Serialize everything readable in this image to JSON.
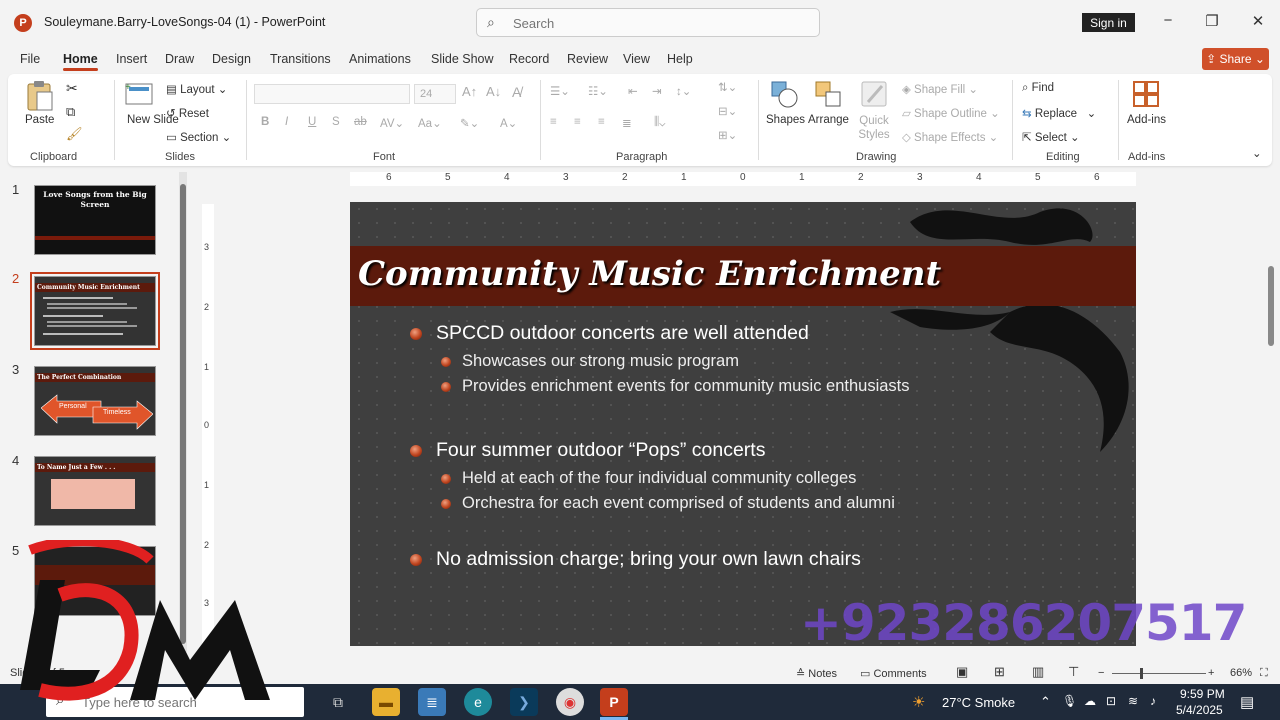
{
  "window": {
    "doc_title": "Souleymane.Barry-LoveSongs-04 (1)  -  PowerPoint",
    "search_placeholder": "Search",
    "sign_in": "Sign in",
    "minimize": "−",
    "restore": "❐",
    "close": "✕"
  },
  "menu": {
    "tabs": [
      "File",
      "Home",
      "Insert",
      "Draw",
      "Design",
      "Transitions",
      "Animations",
      "Slide Show",
      "Record",
      "Review",
      "View",
      "Help"
    ],
    "active": "Home",
    "share": "Share"
  },
  "ribbon": {
    "clipboard": {
      "label": "Clipboard",
      "paste": "Paste"
    },
    "slides": {
      "label": "Slides",
      "new_slide": "New Slide",
      "layout": "Layout",
      "reset": "Reset",
      "section": "Section"
    },
    "font": {
      "label": "Font",
      "size": "24"
    },
    "paragraph": {
      "label": "Paragraph"
    },
    "drawing": {
      "label": "Drawing",
      "shapes": "Shapes",
      "arrange": "Arrange",
      "quick_styles": "Quick Styles",
      "shape_fill": "Shape Fill",
      "shape_outline": "Shape Outline",
      "shape_effects": "Shape Effects"
    },
    "editing": {
      "label": "Editing",
      "find": "Find",
      "replace": "Replace",
      "select": "Select"
    },
    "addins": {
      "label": "Add-ins",
      "button": "Add-ins"
    }
  },
  "thumbnails": [
    {
      "num": "1",
      "title": "Love Songs from the Big Screen"
    },
    {
      "num": "2",
      "title": "Community Music Enrichment",
      "selected": true
    },
    {
      "num": "3",
      "title": "The Perfect Combination",
      "left": "Personal",
      "right": "Timeless"
    },
    {
      "num": "4",
      "title": "To Name Just a Few . . ."
    },
    {
      "num": "5",
      "title": ""
    }
  ],
  "ruler": {
    "h_ticks": [
      "6",
      "5",
      "4",
      "3",
      "2",
      "1",
      "0",
      "1",
      "2",
      "3",
      "4",
      "5",
      "6"
    ],
    "v_ticks": [
      "3",
      "2",
      "1",
      "0",
      "1",
      "2",
      "3"
    ]
  },
  "slide": {
    "title": "Community Music Enrichment",
    "bullets": [
      {
        "text": "SPCCD outdoor concerts are well attended",
        "subs": [
          "Showcases our strong music program",
          "Provides enrichment events for community music enthusiasts"
        ]
      },
      {
        "text": "Four summer outdoor “Pops” concerts",
        "subs": [
          "Held at each of the four individual community colleges",
          "Orchestra for each event comprised of students and alumni"
        ]
      },
      {
        "text": "No admission charge; bring your own lawn chairs",
        "subs": []
      }
    ]
  },
  "statusbar": {
    "slide_info": "Slide 2 of 5",
    "notes": "Notes",
    "comments": "Comments",
    "zoom": "66%"
  },
  "watermark": {
    "phone": "+923286207517"
  },
  "taskbar": {
    "search_placeholder": "Type here to search",
    "weather": "27°C  Smoke",
    "time": "9:59 PM",
    "date": "5/4/2025"
  },
  "colors": {
    "accent": "#c43e1c",
    "title_band": "#5c1a0c",
    "slide_bg": "#3f3f3f"
  }
}
